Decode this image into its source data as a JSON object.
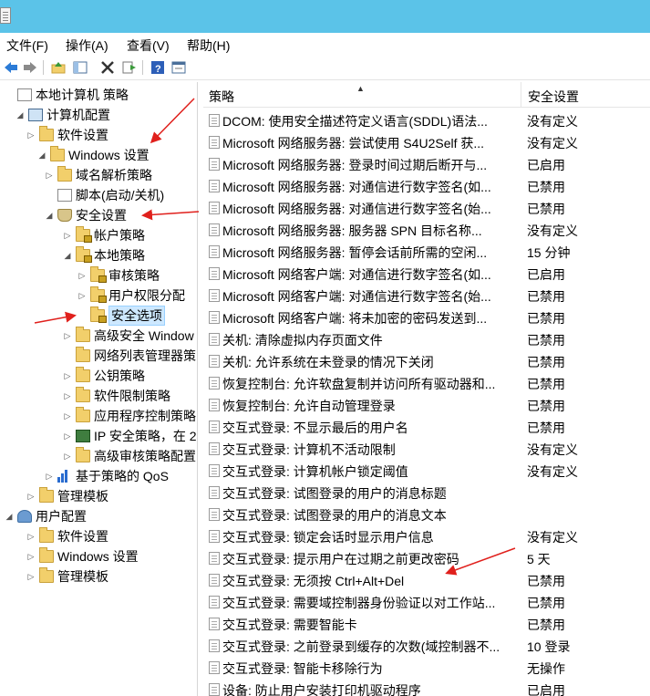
{
  "menu": [
    "文件(F)",
    "操作(A)",
    "查看(V)",
    "帮助(H)"
  ],
  "toolbar_icons": [
    "back-arrow-icon",
    "forward-arrow-icon",
    "up-folder-icon",
    "show-hide-tree-icon",
    "delete-icon",
    "export-list-icon",
    "help-icon",
    "properties-icon"
  ],
  "tree": [
    {
      "label": "本地计算机 策略",
      "arrow": "",
      "icon": "doc"
    },
    {
      "label": "计算机配置",
      "arrow": "◢",
      "icon": "computer"
    },
    {
      "label": "软件设置",
      "arrow": "▷",
      "icon": "folder"
    },
    {
      "label": "Windows 设置",
      "arrow": "◢",
      "icon": "folder"
    },
    {
      "label": "域名解析策略",
      "arrow": "▷",
      "icon": "folder"
    },
    {
      "label": "脚本(启动/关机)",
      "arrow": "",
      "icon": "doc"
    },
    {
      "label": "安全设置",
      "arrow": "◢",
      "icon": "shield"
    },
    {
      "label": "帐户策略",
      "arrow": "▷",
      "icon": "lock-folder"
    },
    {
      "label": "本地策略",
      "arrow": "◢",
      "icon": "lock-folder"
    },
    {
      "label": "审核策略",
      "arrow": "▷",
      "icon": "lock-folder"
    },
    {
      "label": "用户权限分配",
      "arrow": "▷",
      "icon": "lock-folder"
    },
    {
      "label": "安全选项",
      "arrow": "",
      "icon": "lock-folder"
    },
    {
      "label": "高级安全 Window",
      "arrow": "▷",
      "icon": "folder"
    },
    {
      "label": "网络列表管理器策",
      "arrow": "",
      "icon": "folder"
    },
    {
      "label": "公钥策略",
      "arrow": "▷",
      "icon": "folder"
    },
    {
      "label": "软件限制策略",
      "arrow": "▷",
      "icon": "folder"
    },
    {
      "label": "应用程序控制策略",
      "arrow": "▷",
      "icon": "folder"
    },
    {
      "label": "IP 安全策略，在 2",
      "arrow": "▷",
      "icon": "ip"
    },
    {
      "label": "高级审核策略配置",
      "arrow": "▷",
      "icon": "folder"
    },
    {
      "label": "基于策略的 QoS",
      "arrow": "▷",
      "icon": "bars"
    },
    {
      "label": "管理模板",
      "arrow": "▷",
      "icon": "folder"
    },
    {
      "label": "用户配置",
      "arrow": "◢",
      "icon": "user"
    },
    {
      "label": "软件设置",
      "arrow": "▷",
      "icon": "folder"
    },
    {
      "label": "Windows 设置",
      "arrow": "▷",
      "icon": "folder"
    },
    {
      "label": "管理模板",
      "arrow": "▷",
      "icon": "folder"
    }
  ],
  "list": {
    "header_policy": "策略",
    "header_setting": "安全设置",
    "rows": [
      {
        "policy": "DCOM: 使用安全描述符定义语言(SDDL)语法...",
        "setting": "没有定义"
      },
      {
        "policy": "Microsoft 网络服务器: 尝试使用 S4U2Self 获...",
        "setting": "没有定义"
      },
      {
        "policy": "Microsoft 网络服务器: 登录时间过期后断开与...",
        "setting": "已启用"
      },
      {
        "policy": "Microsoft 网络服务器: 对通信进行数字签名(如...",
        "setting": "已禁用"
      },
      {
        "policy": "Microsoft 网络服务器: 对通信进行数字签名(始...",
        "setting": "已禁用"
      },
      {
        "policy": "Microsoft 网络服务器: 服务器 SPN 目标名称...",
        "setting": "没有定义"
      },
      {
        "policy": "Microsoft 网络服务器: 暂停会话前所需的空闲...",
        "setting": "15 分钟"
      },
      {
        "policy": "Microsoft 网络客户端: 对通信进行数字签名(如...",
        "setting": "已启用"
      },
      {
        "policy": "Microsoft 网络客户端: 对通信进行数字签名(始...",
        "setting": "已禁用"
      },
      {
        "policy": "Microsoft 网络客户端: 将未加密的密码发送到...",
        "setting": "已禁用"
      },
      {
        "policy": "关机: 清除虚拟内存页面文件",
        "setting": "已禁用"
      },
      {
        "policy": "关机: 允许系统在未登录的情况下关闭",
        "setting": "已禁用"
      },
      {
        "policy": "恢复控制台: 允许软盘复制并访问所有驱动器和...",
        "setting": "已禁用"
      },
      {
        "policy": "恢复控制台: 允许自动管理登录",
        "setting": "已禁用"
      },
      {
        "policy": "交互式登录: 不显示最后的用户名",
        "setting": "已禁用"
      },
      {
        "policy": "交互式登录: 计算机不活动限制",
        "setting": "没有定义"
      },
      {
        "policy": "交互式登录: 计算机帐户锁定阈值",
        "setting": "没有定义"
      },
      {
        "policy": "交互式登录: 试图登录的用户的消息标题",
        "setting": ""
      },
      {
        "policy": "交互式登录: 试图登录的用户的消息文本",
        "setting": ""
      },
      {
        "policy": "交互式登录: 锁定会话时显示用户信息",
        "setting": "没有定义"
      },
      {
        "policy": "交互式登录: 提示用户在过期之前更改密码",
        "setting": "5 天"
      },
      {
        "policy": "交互式登录: 无须按 Ctrl+Alt+Del",
        "setting": "已禁用"
      },
      {
        "policy": "交互式登录: 需要域控制器身份验证以对工作站...",
        "setting": "已禁用"
      },
      {
        "policy": "交互式登录: 需要智能卡",
        "setting": "已禁用"
      },
      {
        "policy": "交互式登录: 之前登录到缓存的次数(域控制器不...",
        "setting": "10 登录"
      },
      {
        "policy": "交互式登录: 智能卡移除行为",
        "setting": "无操作"
      },
      {
        "policy": "设备: 防止用户安装打印机驱动程序",
        "setting": "已启用"
      }
    ]
  },
  "colors": {
    "titlebar": "#5bc3e8",
    "annotation_arrow": "#e0201c",
    "selection": "#cde8ff"
  }
}
